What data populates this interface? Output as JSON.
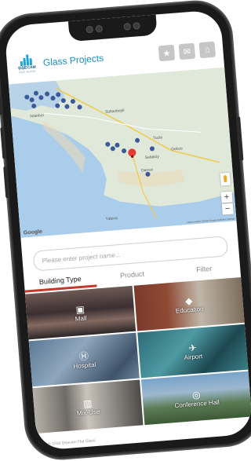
{
  "app": {
    "title": "Glass Projects",
    "logo_text": "ŞİŞECAM",
    "logo_sub": "FLAT GLASS"
  },
  "header_icons": [
    "star-icon",
    "mail-icon",
    "home-icon"
  ],
  "map": {
    "labels": [
      "İstanbul",
      "Sultanbeyli",
      "Gebze",
      "Darıca",
      "Yalova",
      "Sefaköy",
      "Tuzla"
    ],
    "attribution": "Google",
    "footer": "Harita verileri ©2018 Google  Kullanım Şartları"
  },
  "search": {
    "placeholder": "Please enter project name..."
  },
  "tabs": [
    {
      "label": "Building Type",
      "active": true
    },
    {
      "label": "Product",
      "active": false
    },
    {
      "label": "Filter",
      "active": false
    }
  ],
  "categories": [
    {
      "label": "Mall",
      "icon": "shopping-bag-icon"
    },
    {
      "label": "Education",
      "icon": "graduation-cap-icon"
    },
    {
      "label": "Hospital",
      "icon": "hospital-icon"
    },
    {
      "label": "Airport",
      "icon": "airplane-icon"
    },
    {
      "label": "Mix-Use",
      "icon": "building-icon"
    },
    {
      "label": "Conference Hall",
      "icon": "conference-icon"
    }
  ],
  "footer": {
    "copyright": "© 2018 Şişecam Flat Glass"
  },
  "colors": {
    "accent": "#1b8ec5",
    "active_tab": "#c0392b",
    "marker": "#3a5a9b",
    "selected_marker": "#e53935"
  }
}
